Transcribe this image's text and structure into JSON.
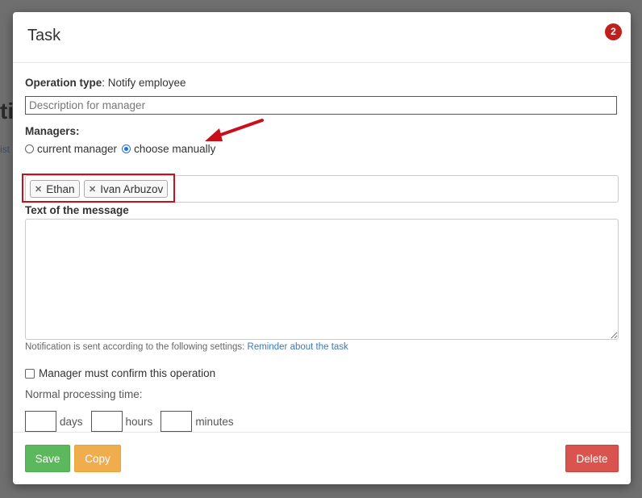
{
  "background": {
    "fragment_1": "ti",
    "fragment_2": "ist"
  },
  "modal": {
    "title": "Task",
    "badge_count": "2"
  },
  "operation": {
    "label": "Operation type",
    "value": ": Notify employee"
  },
  "description": {
    "placeholder": "Description for manager"
  },
  "managers": {
    "label": "Managers:",
    "option_current": "current manager",
    "option_manual": "choose manually",
    "selected": "choose manually",
    "tags": [
      "Ethan",
      "Ivan Arbuzov"
    ]
  },
  "message": {
    "label": "Text of the message"
  },
  "notice": {
    "text": "Notification is sent according to the following settings: ",
    "link": "Reminder about the task"
  },
  "confirm": {
    "label": "Manager must confirm this operation"
  },
  "processing": {
    "label": "Normal processing time:",
    "days": "days",
    "hours": "hours",
    "minutes": "minutes"
  },
  "footer": {
    "save": "Save",
    "copy": "Copy",
    "delete": "Delete"
  },
  "colors": {
    "highlight": "#c8101a",
    "badge": "#c0201c",
    "save": "#5cb85c",
    "copy": "#f0ad4e",
    "delete": "#d9534f",
    "link": "#3a7ab8"
  }
}
